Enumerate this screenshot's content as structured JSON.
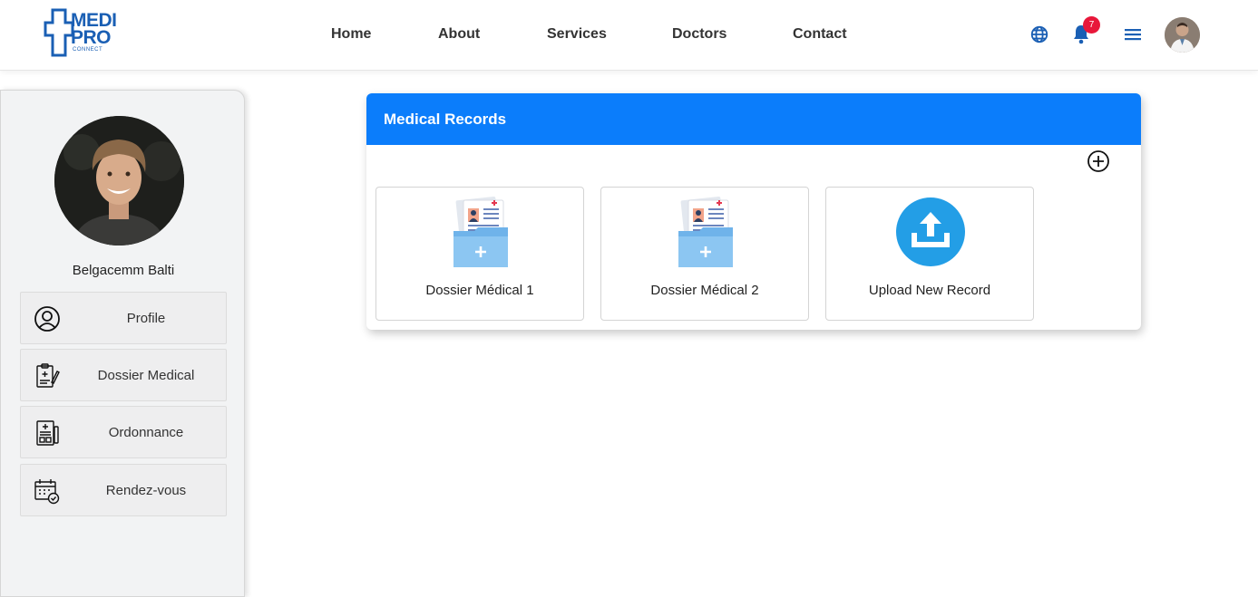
{
  "brand": {
    "line1": "MEDI",
    "line2": "PRO",
    "sub": "CONNECT",
    "color": "#1a5fb4"
  },
  "nav": {
    "items": [
      {
        "label": "Home"
      },
      {
        "label": "About"
      },
      {
        "label": "Services"
      },
      {
        "label": "Doctors"
      },
      {
        "label": "Contact"
      }
    ]
  },
  "header": {
    "icons": [
      "globe-icon",
      "bell-icon",
      "menu-icon"
    ],
    "notification_count": "7",
    "accent": "#1a5fb4"
  },
  "sidebar": {
    "user_name": "Belgacemm Balti",
    "items": [
      {
        "label": "Profile",
        "icon": "user-circle-icon"
      },
      {
        "label": "Dossier Medical",
        "icon": "clipboard-pen-icon"
      },
      {
        "label": "Ordonnance",
        "icon": "prescription-icon"
      },
      {
        "label": "Rendez-vous",
        "icon": "calendar-check-icon"
      }
    ]
  },
  "records": {
    "title": "Medical Records",
    "header_color": "#0b7dfb",
    "add_icon": "plus-circle-icon",
    "items": [
      {
        "label": "Dossier Médical 1",
        "icon": "medical-folder-icon"
      },
      {
        "label": "Dossier Médical 2",
        "icon": "medical-folder-icon"
      },
      {
        "label": "Upload New Record",
        "icon": "upload-icon"
      }
    ]
  }
}
